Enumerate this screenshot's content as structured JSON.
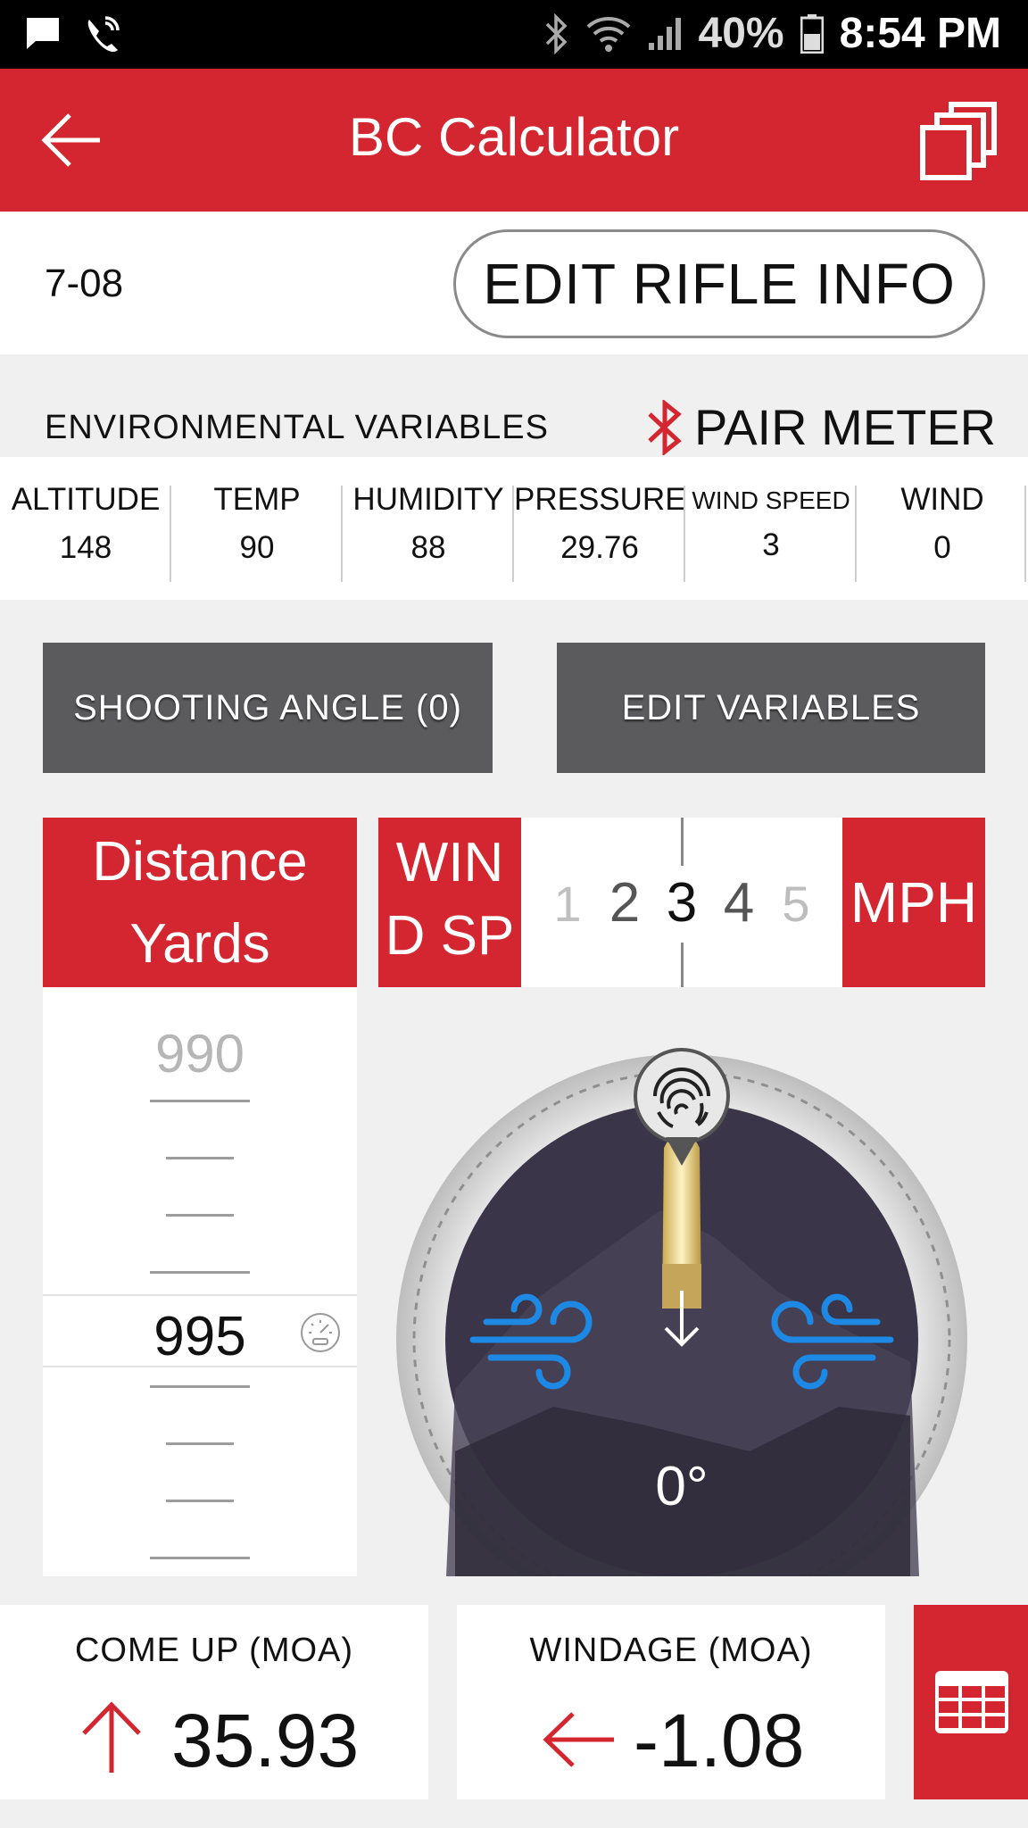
{
  "status_bar": {
    "battery": "40%",
    "time": "8:54 PM"
  },
  "app_bar": {
    "title": "BC Calculator"
  },
  "rifle": {
    "name": "7-08",
    "edit_label": "EDIT RIFLE INFO"
  },
  "environment": {
    "title": "ENVIRONMENTAL VARIABLES",
    "pair_label": "PAIR METER",
    "variables": [
      {
        "label": "ALTITUDE",
        "value": "148"
      },
      {
        "label": "TEMP",
        "value": "90"
      },
      {
        "label": "HUMIDITY",
        "value": "88"
      },
      {
        "label": "PRESSURE",
        "value": "29.76"
      },
      {
        "label": "WIND SPEED",
        "value": "3"
      },
      {
        "label": "WIND",
        "value": "0"
      }
    ]
  },
  "buttons": {
    "shooting_angle": "SHOOTING ANGLE (0)",
    "edit_variables": "EDIT VARIABLES"
  },
  "distance": {
    "header_line1": "Distance",
    "header_line2": "Yards",
    "previous_value": "990",
    "selected_value": "995"
  },
  "wind_speed": {
    "label_line1": "WIN",
    "label_line2": "D SP",
    "options": [
      "1",
      "2",
      "3",
      "4",
      "5"
    ],
    "selected": "3",
    "unit": "MPH"
  },
  "compass": {
    "angle_label": "0°"
  },
  "results": {
    "come_up_label": "COME UP (MOA)",
    "come_up_value": "35.93",
    "windage_label": "WINDAGE (MOA)",
    "windage_value": "-1.08"
  },
  "colors": {
    "brand_red": "#d32630",
    "button_gray": "#5b5b5d",
    "wind_blue": "#1e88e5"
  }
}
